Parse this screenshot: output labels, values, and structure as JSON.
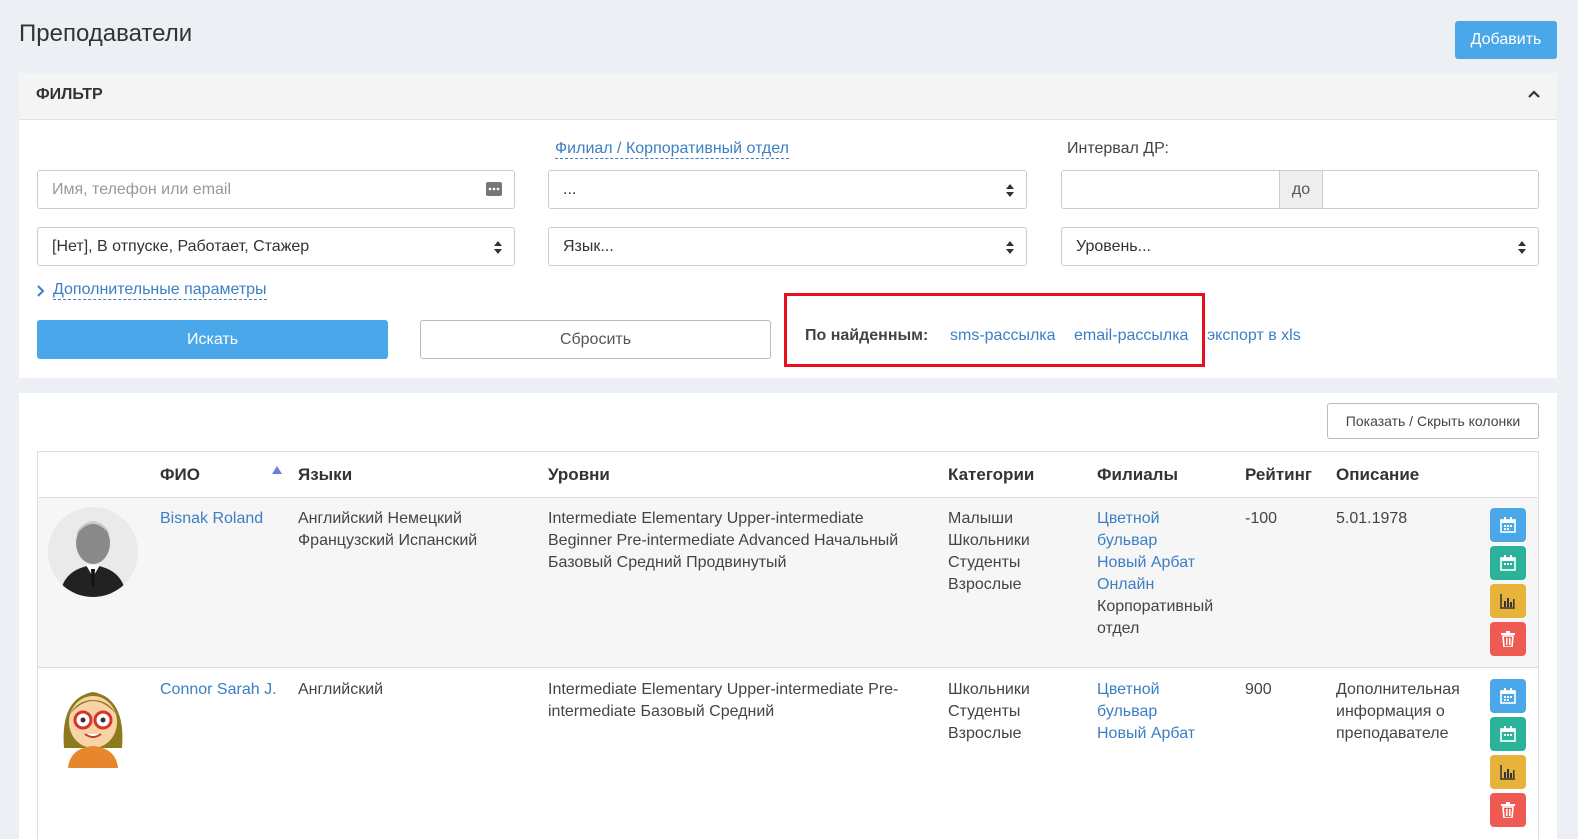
{
  "page": {
    "title": "Преподаватели",
    "add_label": "Добавить"
  },
  "filter": {
    "title": "ФИЛЬТР",
    "search_placeholder": "Имя, телефон или email",
    "branch_label": "Филиал / Корпоративный отдел",
    "branch_value": "...",
    "birthday_label": "Интервал ДР:",
    "birthday_to": "до",
    "status_value": "[Нет], В отпуске, Работает, Стажер",
    "language_value": "Язык...",
    "level_value": "Уровень...",
    "more_params": "Дополнительные параметры",
    "search_btn": "Искать",
    "reset_btn": "Сбросить",
    "found_label": "По найденным:",
    "sms_link": "sms-рассылка",
    "email_link": "email-рассылка",
    "export_link": "экспорт в xls"
  },
  "table": {
    "toggle_columns": "Показать / Скрыть колонки",
    "headers": {
      "name": "ФИО",
      "languages": "Языки",
      "levels": "Уровни",
      "categories": "Категории",
      "branches": "Филиалы",
      "rating": "Рейтинг",
      "description": "Описание"
    },
    "rows": [
      {
        "name": "Bisnak Roland",
        "languages": [
          "Английский Немецкий",
          "Французский Испанский"
        ],
        "levels": [
          "Intermediate Elementary Upper-intermediate",
          "Beginner Pre-intermediate Advanced Начальный",
          "Базовый Средний Продвинутый"
        ],
        "categories": [
          "Малыши",
          "Школьники",
          "Студенты",
          "Взрослые"
        ],
        "branches_links": [
          "Цветной",
          "бульвар",
          "Новый Арбат",
          "Онлайн"
        ],
        "branches_plain": [
          "Корпоративный",
          "отдел"
        ],
        "rating": "-100",
        "description": [
          "5.01.1978"
        ]
      },
      {
        "name": "Connor Sarah J.",
        "languages": [
          "Английский"
        ],
        "levels": [
          "Intermediate Elementary Upper-intermediate Pre-",
          "intermediate Базовый Средний"
        ],
        "categories": [
          "Школьники",
          "Студенты",
          "Взрослые"
        ],
        "branches_links": [
          "Цветной",
          "бульвар",
          "Новый Арбат"
        ],
        "branches_plain": [],
        "rating": "900",
        "description": [
          "Дополнительная",
          "информация о",
          "преподавателе"
        ]
      }
    ]
  },
  "colors": {
    "primary": "#4aa8ea",
    "link": "#3b7fc4",
    "highlight": "#e8101f",
    "green": "#2bb39a",
    "yellow": "#e7b33b",
    "red": "#ef5a52"
  }
}
